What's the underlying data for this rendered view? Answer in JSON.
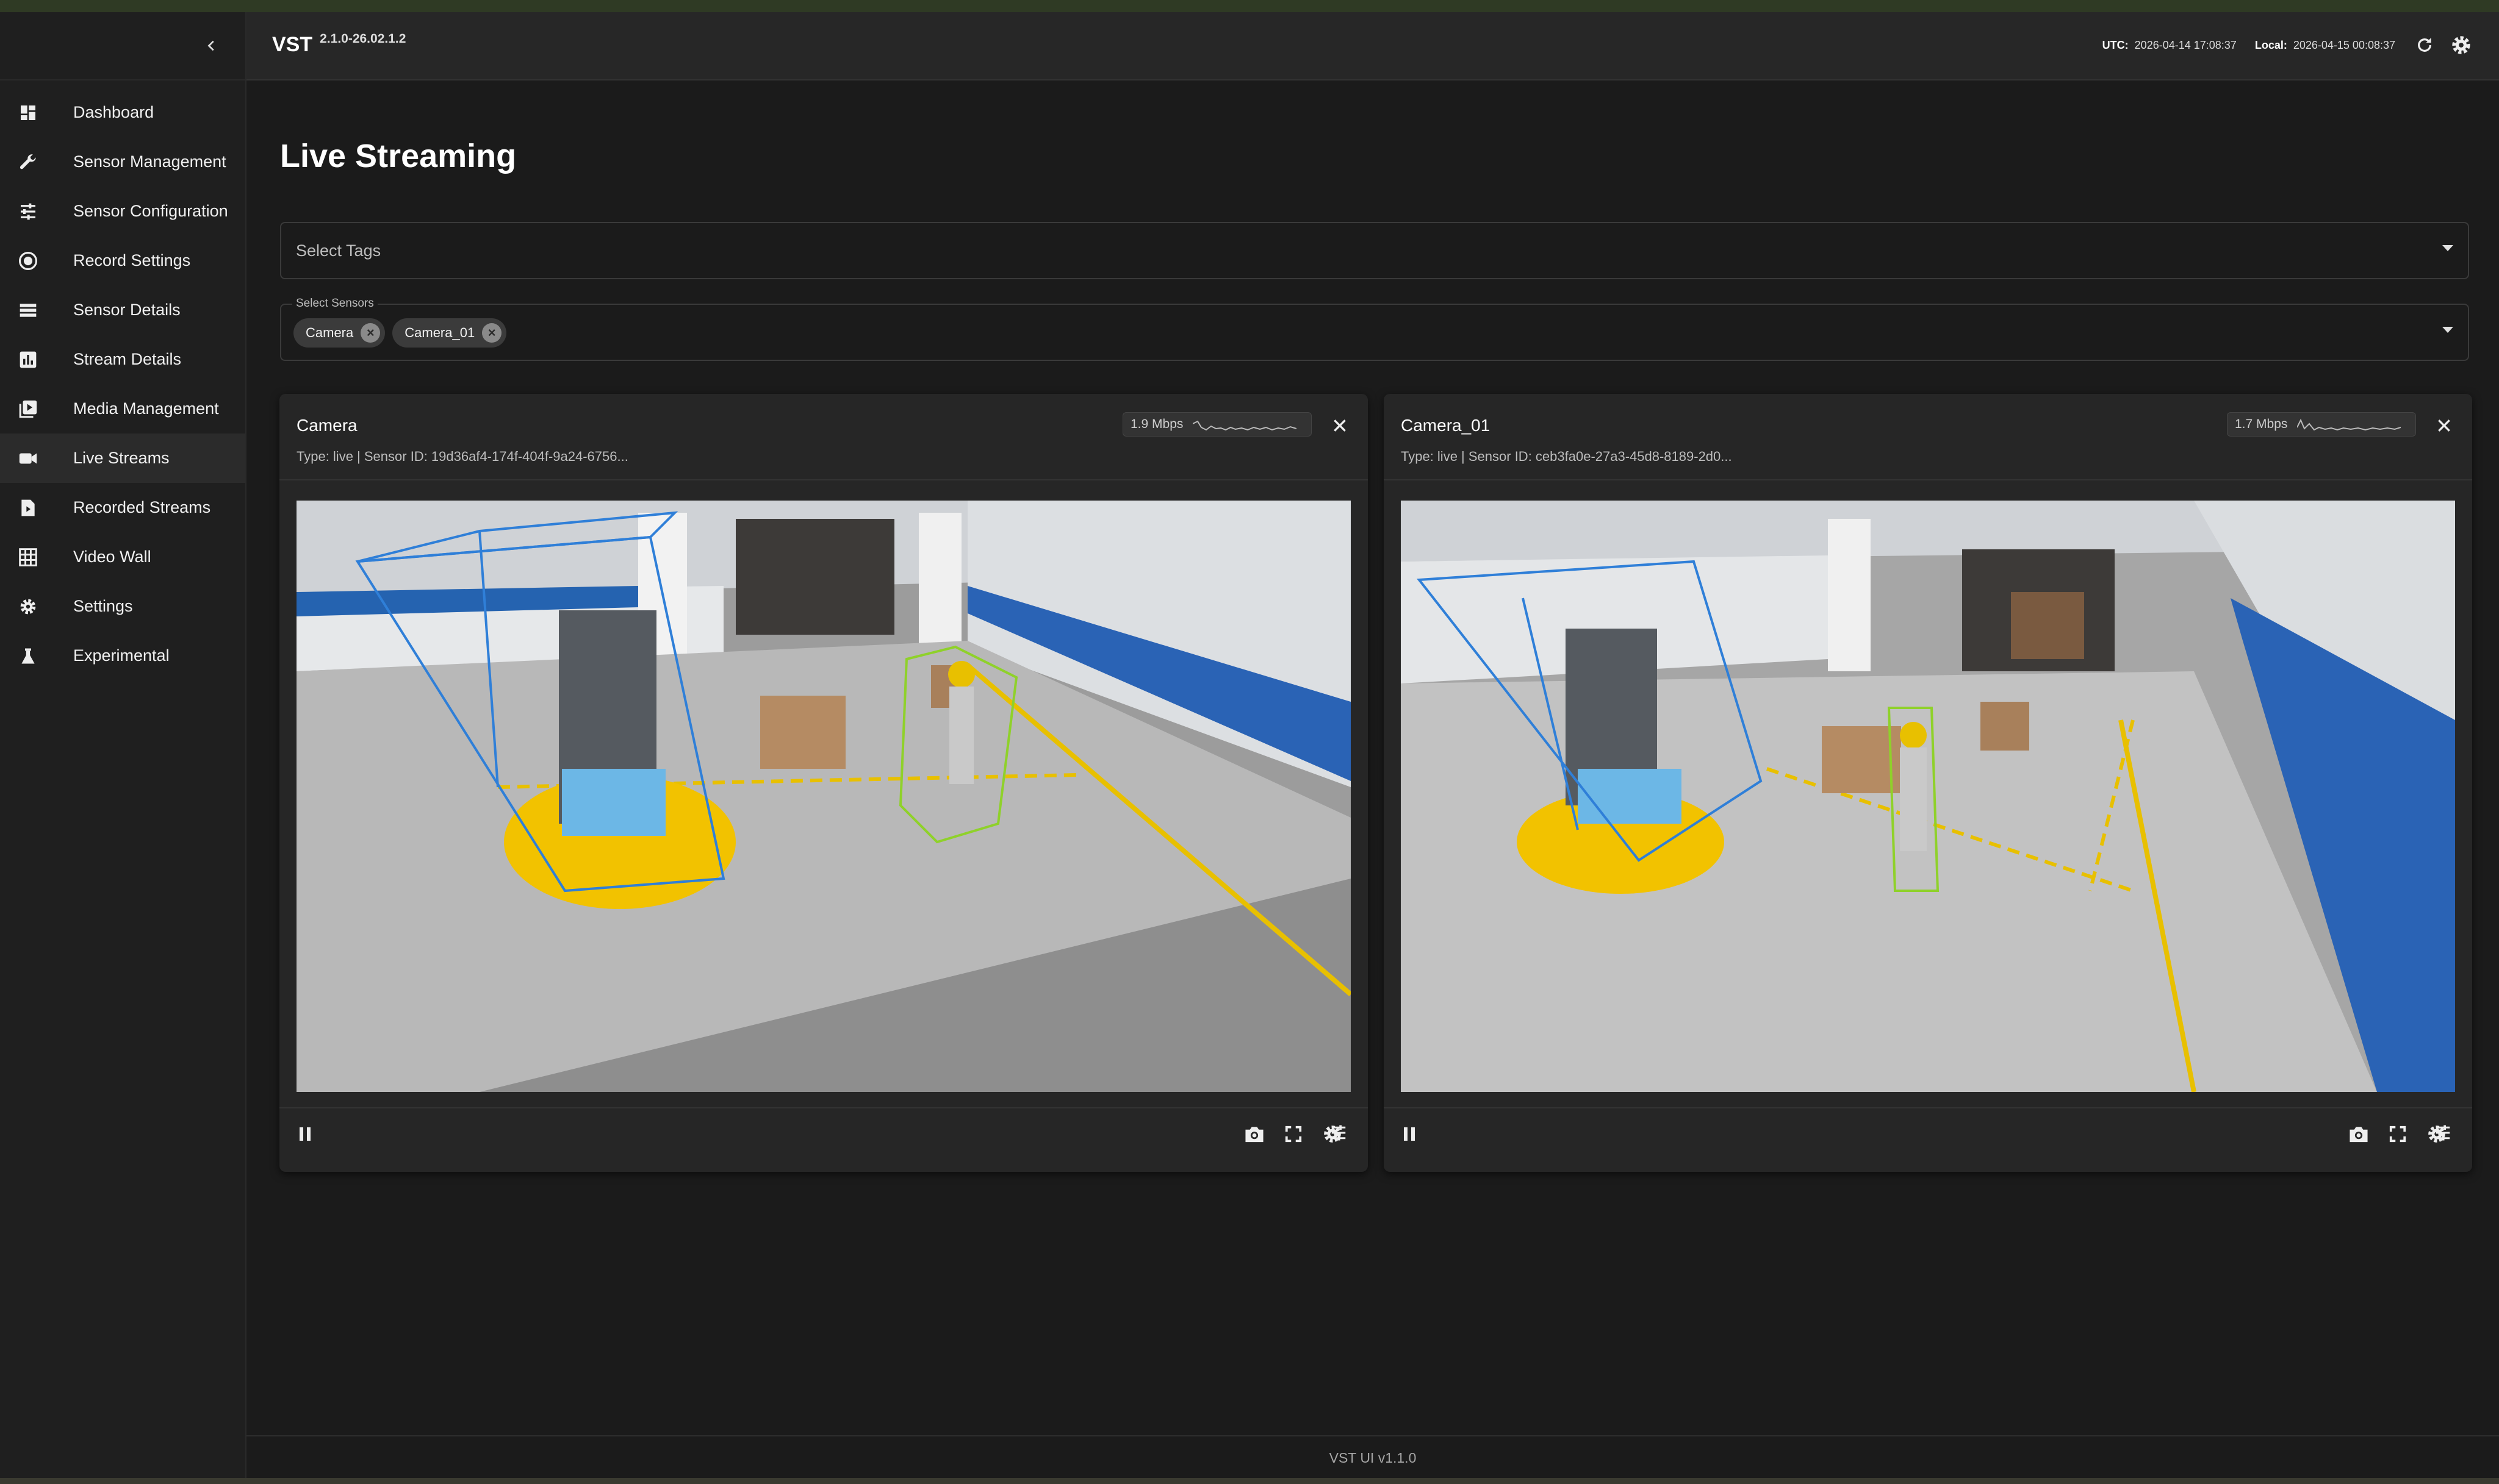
{
  "app": {
    "brand": "VST",
    "version": "2.1.0-26.02.1.2"
  },
  "header": {
    "utc_label": "UTC:",
    "utc_value": "2026-04-14 17:08:37",
    "local_label": "Local:",
    "local_value": "2026-04-15 00:08:37",
    "refresh_icon": "refresh-icon",
    "settings_icon": "gear-icon"
  },
  "sidebar": {
    "collapse_icon": "chevron-left-icon",
    "items": [
      {
        "label": "Dashboard",
        "icon": "dashboard-icon",
        "active": false
      },
      {
        "label": "Sensor Management",
        "icon": "wrench-icon",
        "active": false
      },
      {
        "label": "Sensor Configuration",
        "icon": "sliders-icon",
        "active": false
      },
      {
        "label": "Record Settings",
        "icon": "record-icon",
        "active": false
      },
      {
        "label": "Sensor Details",
        "icon": "list-icon",
        "active": false
      },
      {
        "label": "Stream Details",
        "icon": "bar-chart-icon",
        "active": false
      },
      {
        "label": "Media Management",
        "icon": "video-library-icon",
        "active": false
      },
      {
        "label": "Live Streams",
        "icon": "video-camera-icon",
        "active": true
      },
      {
        "label": "Recorded Streams",
        "icon": "file-video-icon",
        "active": false
      },
      {
        "label": "Video Wall",
        "icon": "grid-icon",
        "active": false
      },
      {
        "label": "Settings",
        "icon": "gear-icon",
        "active": false
      },
      {
        "label": "Experimental",
        "icon": "flask-icon",
        "active": false
      }
    ]
  },
  "main": {
    "title": "Live Streaming",
    "tags_placeholder": "Select Tags",
    "sensors_label": "Select Sensors",
    "selected_sensors": [
      "Camera",
      "Camera_01"
    ]
  },
  "streams": [
    {
      "name": "Camera",
      "subtitle": "Type: live | Sensor ID: 19d36af4-174f-404f-9a24-6756...",
      "bitrate": "1.9 Mbps"
    },
    {
      "name": "Camera_01",
      "subtitle": "Type: live | Sensor ID: ceb3fa0e-27a3-45d8-8189-2d0...",
      "bitrate": "1.7 Mbps"
    }
  ],
  "footer": {
    "text": "VST UI v1.1.0"
  },
  "colors": {
    "background": "#1b1b1b",
    "sidebar": "#1f1f1f",
    "card": "#262626",
    "box_forklift": "#2f7fd8",
    "box_person": "#8fd12a",
    "floor_marking": "#f2c200"
  }
}
